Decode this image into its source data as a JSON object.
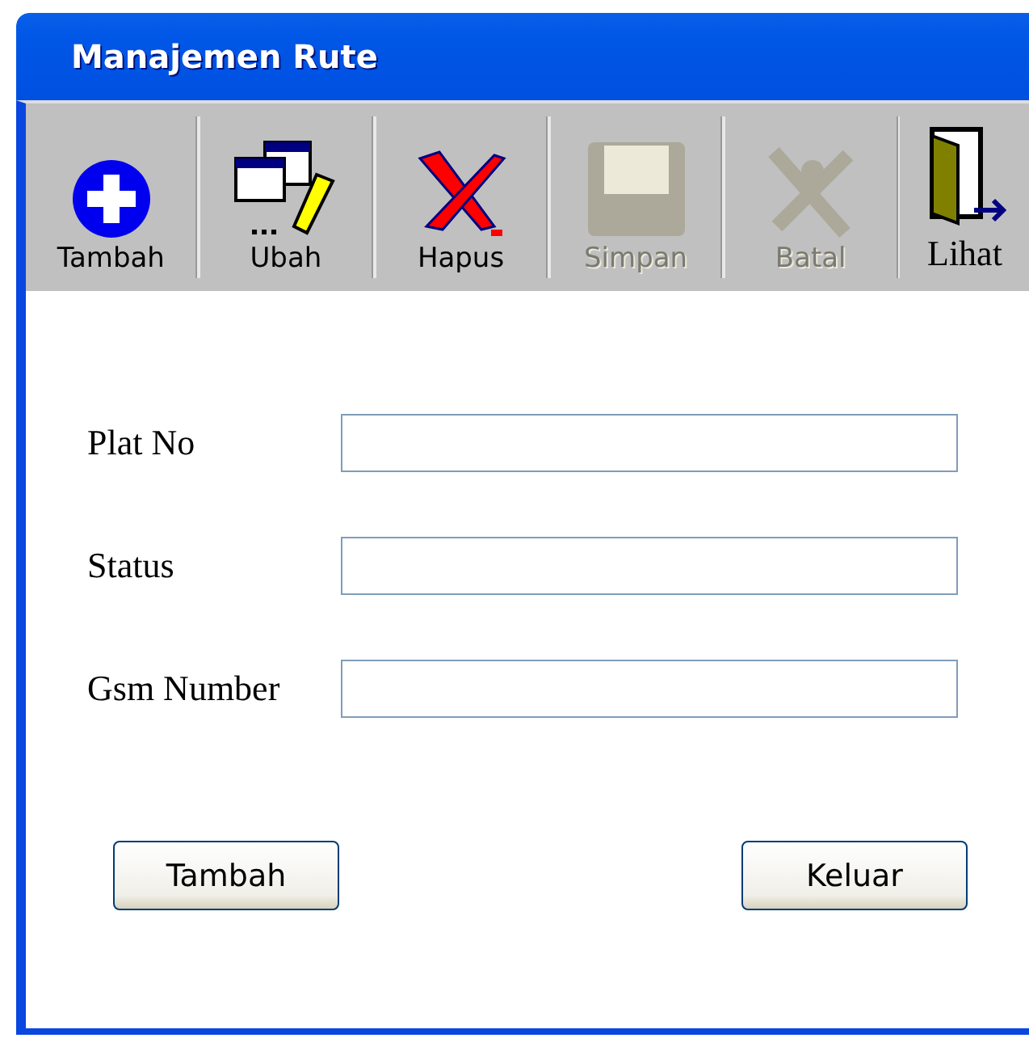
{
  "window": {
    "title": "Manajemen Rute"
  },
  "toolbar": [
    {
      "kind": "add",
      "label": "Tambah",
      "disabled": false
    },
    {
      "kind": "edit",
      "label": "Ubah",
      "disabled": false
    },
    {
      "kind": "delete",
      "label": "Hapus",
      "disabled": false
    },
    {
      "kind": "save",
      "label": "Simpan",
      "disabled": true
    },
    {
      "kind": "cancel",
      "label": "Batal",
      "disabled": true
    },
    {
      "kind": "view",
      "label": "Lihat",
      "disabled": false
    }
  ],
  "form": [
    {
      "label": "Plat No"
    },
    {
      "label": "Status"
    },
    {
      "label": "Gsm Number"
    }
  ],
  "buttons": [
    "Tambah",
    "Keluar"
  ]
}
